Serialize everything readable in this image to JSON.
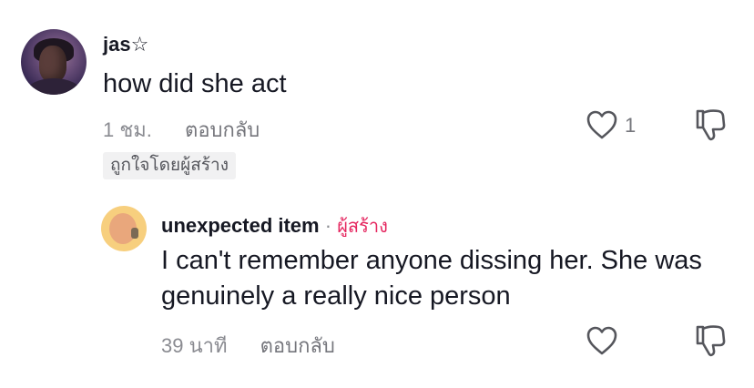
{
  "comment": {
    "username": "jas☆",
    "text": "how did she act",
    "time": "1 ชม.",
    "reply_label": "ตอบกลับ",
    "like_count": "1",
    "liked_by_creator": "ถูกใจโดยผู้สร้าง"
  },
  "reply": {
    "username": "unexpected item",
    "separator": "·",
    "creator_label": "ผู้สร้าง",
    "text": "I can't remember anyone dissing her. She was genuinely a really nice person",
    "time": "39 นาที",
    "reply_label": "ตอบกลับ"
  },
  "colors": {
    "creator": "#e5265f",
    "secondary_text": "#8a8b91"
  },
  "icons": [
    "avatar",
    "heart-icon",
    "dislike-icon"
  ]
}
